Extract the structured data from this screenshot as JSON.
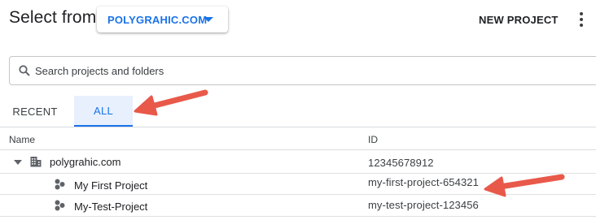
{
  "header": {
    "title": "Select from",
    "org_selector": "POLYGRAHIC.COM",
    "new_project_label": "NEW PROJECT"
  },
  "search": {
    "placeholder": "Search projects and folders",
    "value": ""
  },
  "tabs": [
    {
      "label": "RECENT",
      "selected": false
    },
    {
      "label": "ALL",
      "selected": true
    }
  ],
  "table": {
    "columns": [
      "Name",
      "ID"
    ],
    "rows": [
      {
        "name": "polygrahic.com",
        "id": "12345678912",
        "type": "organization"
      },
      {
        "name": "My First Project",
        "id": "my-first-project-654321",
        "type": "project"
      },
      {
        "name": "My-Test-Project",
        "id": "my-test-project-123456",
        "type": "project"
      }
    ]
  },
  "colors": {
    "accent": "#1a73e8",
    "tab_selected_bg": "#e8f0fe",
    "annotation_arrow": "#e8594a"
  },
  "icons": {
    "search": "search-icon",
    "more": "more-vert-icon",
    "expand": "expand-caret-icon",
    "organization": "building-icon",
    "project": "project-hexagon-icon",
    "dropdown": "caret-down-icon",
    "annotation": "arrow-annotation"
  }
}
